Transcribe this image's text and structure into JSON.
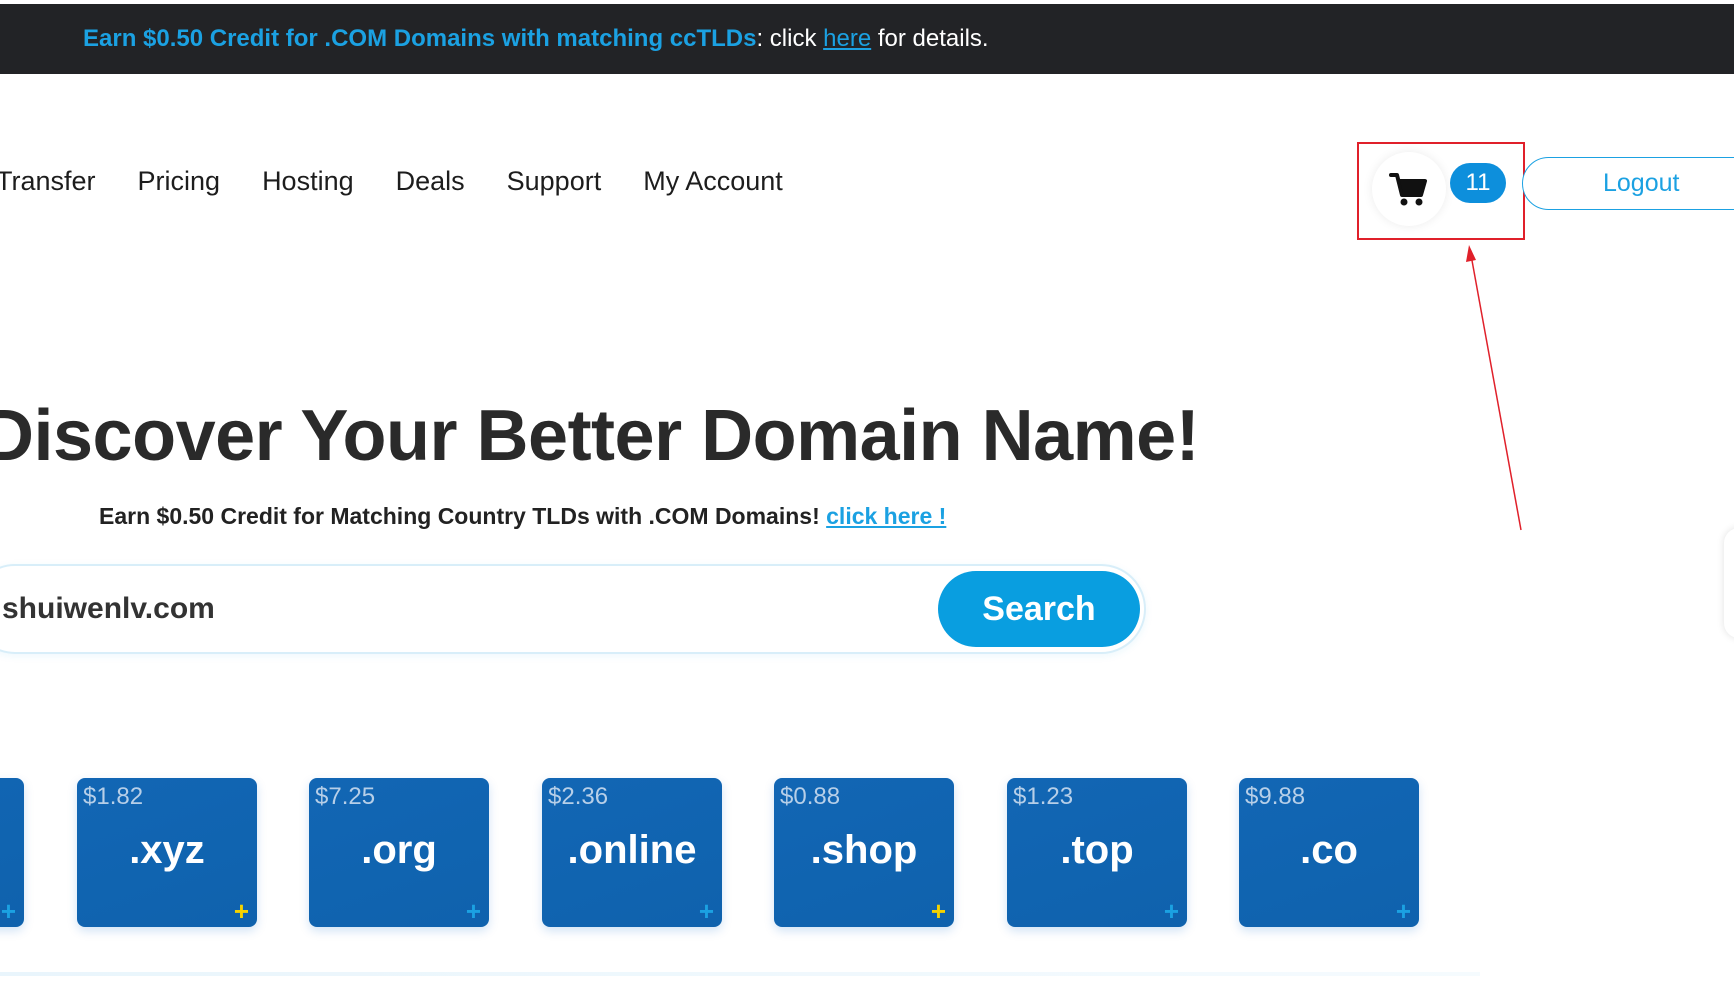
{
  "promo": {
    "highlight": "Earn $0.50 Credit for .COM Domains with matching ccTLDs",
    "text_before_link": ": click ",
    "link": "here",
    "text_after_link": " for details."
  },
  "nav": {
    "items": [
      {
        "label": "Transfer"
      },
      {
        "label": "Pricing"
      },
      {
        "label": "Hosting"
      },
      {
        "label": "Deals"
      },
      {
        "label": "Support"
      },
      {
        "label": "My Account"
      }
    ]
  },
  "cart": {
    "icon": "shopping-cart-icon",
    "count": "11"
  },
  "logout_label": "Logout",
  "hero": {
    "title": "Discover Your Better Domain Name!",
    "subtitle": "Earn $0.50 Credit for Matching Country TLDs with .COM Domains! ",
    "subtitle_link": "click here !"
  },
  "search": {
    "value": "shuiwenlv.com",
    "button_label": "Search"
  },
  "tiles": [
    {
      "price": "",
      "tld": "",
      "plus_color": "#1ba1e2"
    },
    {
      "price": "$1.82",
      "tld": ".xyz",
      "plus_color": "#f5d200"
    },
    {
      "price": "$7.25",
      "tld": ".org",
      "plus_color": "#1ba1e2"
    },
    {
      "price": "$2.36",
      "tld": ".online",
      "plus_color": "#1ba1e2"
    },
    {
      "price": "$0.88",
      "tld": ".shop",
      "plus_color": "#f5d200"
    },
    {
      "price": "$1.23",
      "tld": ".top",
      "plus_color": "#1ba1e2"
    },
    {
      "price": "$9.88",
      "tld": ".co",
      "plus_color": "#1ba1e2"
    }
  ],
  "annotation_color": "#e0202a",
  "accent_color": "#1ba1e2"
}
